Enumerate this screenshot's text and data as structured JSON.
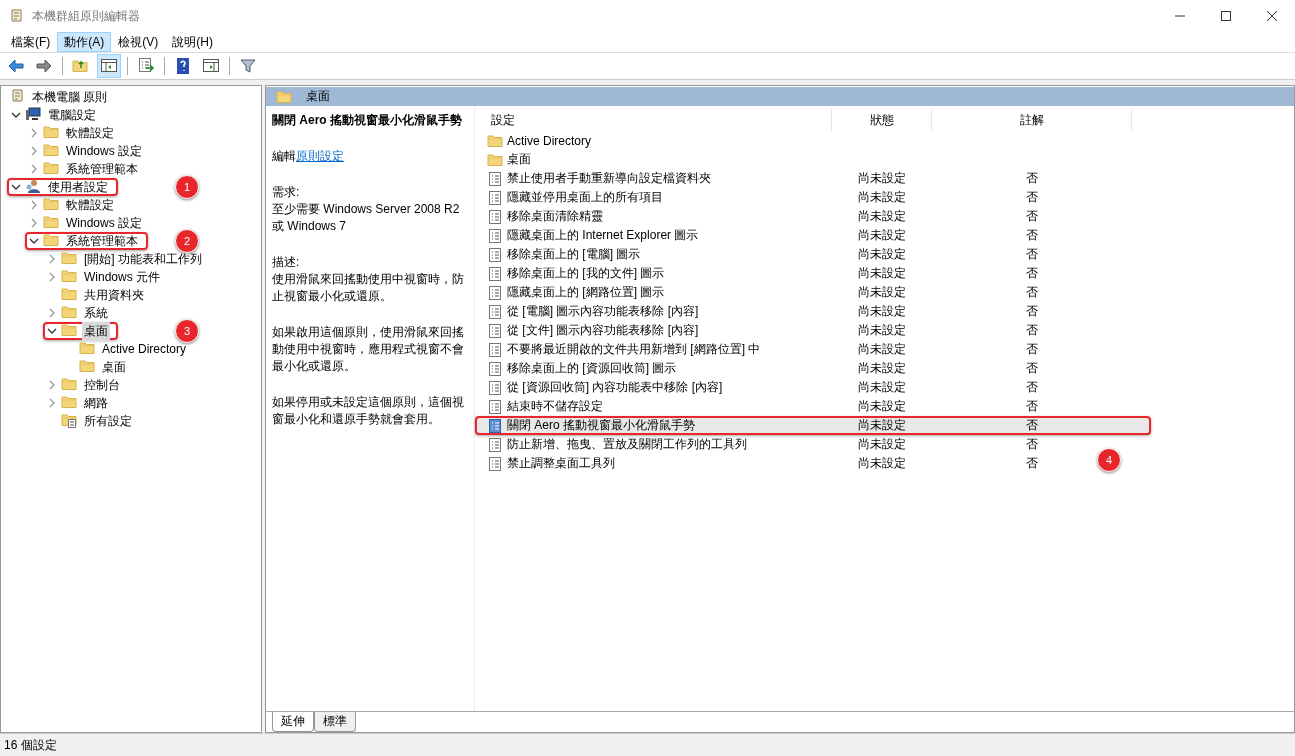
{
  "window": {
    "title": "本機群組原則編輯器"
  },
  "menu": [
    {
      "label": "檔案(F)",
      "selected": false
    },
    {
      "label": "動作(A)",
      "selected": true
    },
    {
      "label": "檢視(V)",
      "selected": false
    },
    {
      "label": "說明(H)",
      "selected": false
    }
  ],
  "tree": {
    "label": "本機電腦 原則",
    "kind": "policy",
    "children": [
      {
        "label": "電腦設定",
        "kind": "computer",
        "expanded": true,
        "children": [
          {
            "label": "軟體設定",
            "kind": "folder",
            "expanded": false
          },
          {
            "label": "Windows 設定",
            "kind": "folder",
            "expanded": false
          },
          {
            "label": "系統管理範本",
            "kind": "folder",
            "expanded": false
          }
        ]
      },
      {
        "label": "使用者設定",
        "kind": "user",
        "expanded": true,
        "highlight": true,
        "callout": "1",
        "children": [
          {
            "label": "軟體設定",
            "kind": "folder",
            "expanded": false
          },
          {
            "label": "Windows 設定",
            "kind": "folder",
            "expanded": false
          },
          {
            "label": "系統管理範本",
            "kind": "folder",
            "expanded": true,
            "highlight": true,
            "callout": "2",
            "children": [
              {
                "label": "[開始] 功能表和工作列",
                "kind": "folder",
                "expanded": false
              },
              {
                "label": "Windows 元件",
                "kind": "folder",
                "expanded": false
              },
              {
                "label": "共用資料夾",
                "kind": "folder"
              },
              {
                "label": "系統",
                "kind": "folder",
                "expanded": false
              },
              {
                "label": "桌面",
                "kind": "folder",
                "expanded": true,
                "selected": true,
                "highlight": true,
                "callout": "3",
                "children": [
                  {
                    "label": "Active Directory",
                    "kind": "folder"
                  },
                  {
                    "label": "桌面",
                    "kind": "folder"
                  }
                ]
              },
              {
                "label": "控制台",
                "kind": "folder",
                "expanded": false
              },
              {
                "label": "網路",
                "kind": "folder",
                "expanded": false
              },
              {
                "label": "所有設定",
                "kind": "settings"
              }
            ]
          }
        ]
      }
    ]
  },
  "header": {
    "title": "桌面"
  },
  "description": {
    "title": "關閉 Aero 搖動視窗最小化滑鼠手勢",
    "edit_prefix": "編輯",
    "edit_link": "原則設定",
    "sections": [
      {
        "heading": "需求:",
        "text": "至少需要 Windows Server 2008 R2 或 Windows 7"
      },
      {
        "heading": "描述:",
        "text": "使用滑鼠來回搖動使用中視窗時，防止視窗最小化或還原。"
      },
      {
        "text": "如果啟用這個原則，使用滑鼠來回搖動使用中視窗時，應用程式視窗不會最小化或還原。"
      },
      {
        "text": "如果停用或未設定這個原則，這個視窗最小化和還原手勢就會套用。"
      }
    ]
  },
  "list": {
    "columns": [
      "設定",
      "狀態",
      "註解"
    ],
    "rows": [
      {
        "kind": "folder",
        "name": "Active Directory"
      },
      {
        "kind": "folder",
        "name": "桌面"
      },
      {
        "kind": "setting",
        "name": "禁止使用者手動重新導向設定檔資料夾",
        "state": "尚未設定",
        "comment": "否",
        "selected": false
      },
      {
        "kind": "setting",
        "name": "隱藏並停用桌面上的所有項目",
        "state": "尚未設定",
        "comment": "否",
        "selected": false
      },
      {
        "kind": "setting",
        "name": "移除桌面清除精靈",
        "state": "尚未設定",
        "comment": "否",
        "selected": false
      },
      {
        "kind": "setting",
        "name": "隱藏桌面上的 Internet Explorer 圖示",
        "state": "尚未設定",
        "comment": "否",
        "selected": false
      },
      {
        "kind": "setting",
        "name": "移除桌面上的 [電腦] 圖示",
        "state": "尚未設定",
        "comment": "否",
        "selected": false
      },
      {
        "kind": "setting",
        "name": "移除桌面上的 [我的文件] 圖示",
        "state": "尚未設定",
        "comment": "否",
        "selected": false
      },
      {
        "kind": "setting",
        "name": "隱藏桌面上的 [網路位置] 圖示",
        "state": "尚未設定",
        "comment": "否",
        "selected": false
      },
      {
        "kind": "setting",
        "name": "從 [電腦] 圖示內容功能表移除 [內容]",
        "state": "尚未設定",
        "comment": "否",
        "selected": false
      },
      {
        "kind": "setting",
        "name": "從 [文件] 圖示內容功能表移除 [內容]",
        "state": "尚未設定",
        "comment": "否",
        "selected": false
      },
      {
        "kind": "setting",
        "name": "不要將最近開啟的文件共用新增到 [網路位置] 中",
        "state": "尚未設定",
        "comment": "否",
        "selected": false
      },
      {
        "kind": "setting",
        "name": "移除桌面上的 [資源回收筒] 圖示",
        "state": "尚未設定",
        "comment": "否",
        "selected": false
      },
      {
        "kind": "setting",
        "name": "從 [資源回收筒] 內容功能表中移除 [內容]",
        "state": "尚未設定",
        "comment": "否",
        "selected": false
      },
      {
        "kind": "setting",
        "name": "結束時不儲存設定",
        "state": "尚未設定",
        "comment": "否",
        "selected": false
      },
      {
        "kind": "setting",
        "name": "關閉 Aero 搖動視窗最小化滑鼠手勢",
        "state": "尚未設定",
        "comment": "否",
        "selected": true,
        "highlight": true,
        "callout": "4"
      },
      {
        "kind": "setting",
        "name": "防止新增、拖曳、置放及關閉工作列的工具列",
        "state": "尚未設定",
        "comment": "否",
        "selected": false
      },
      {
        "kind": "setting",
        "name": "禁止調整桌面工具列",
        "state": "尚未設定",
        "comment": "否",
        "selected": false
      }
    ]
  },
  "view_tabs": [
    {
      "label": "延伸",
      "selected": true
    },
    {
      "label": "標準",
      "selected": false
    }
  ],
  "status_bar": {
    "text": "16 個設定"
  }
}
